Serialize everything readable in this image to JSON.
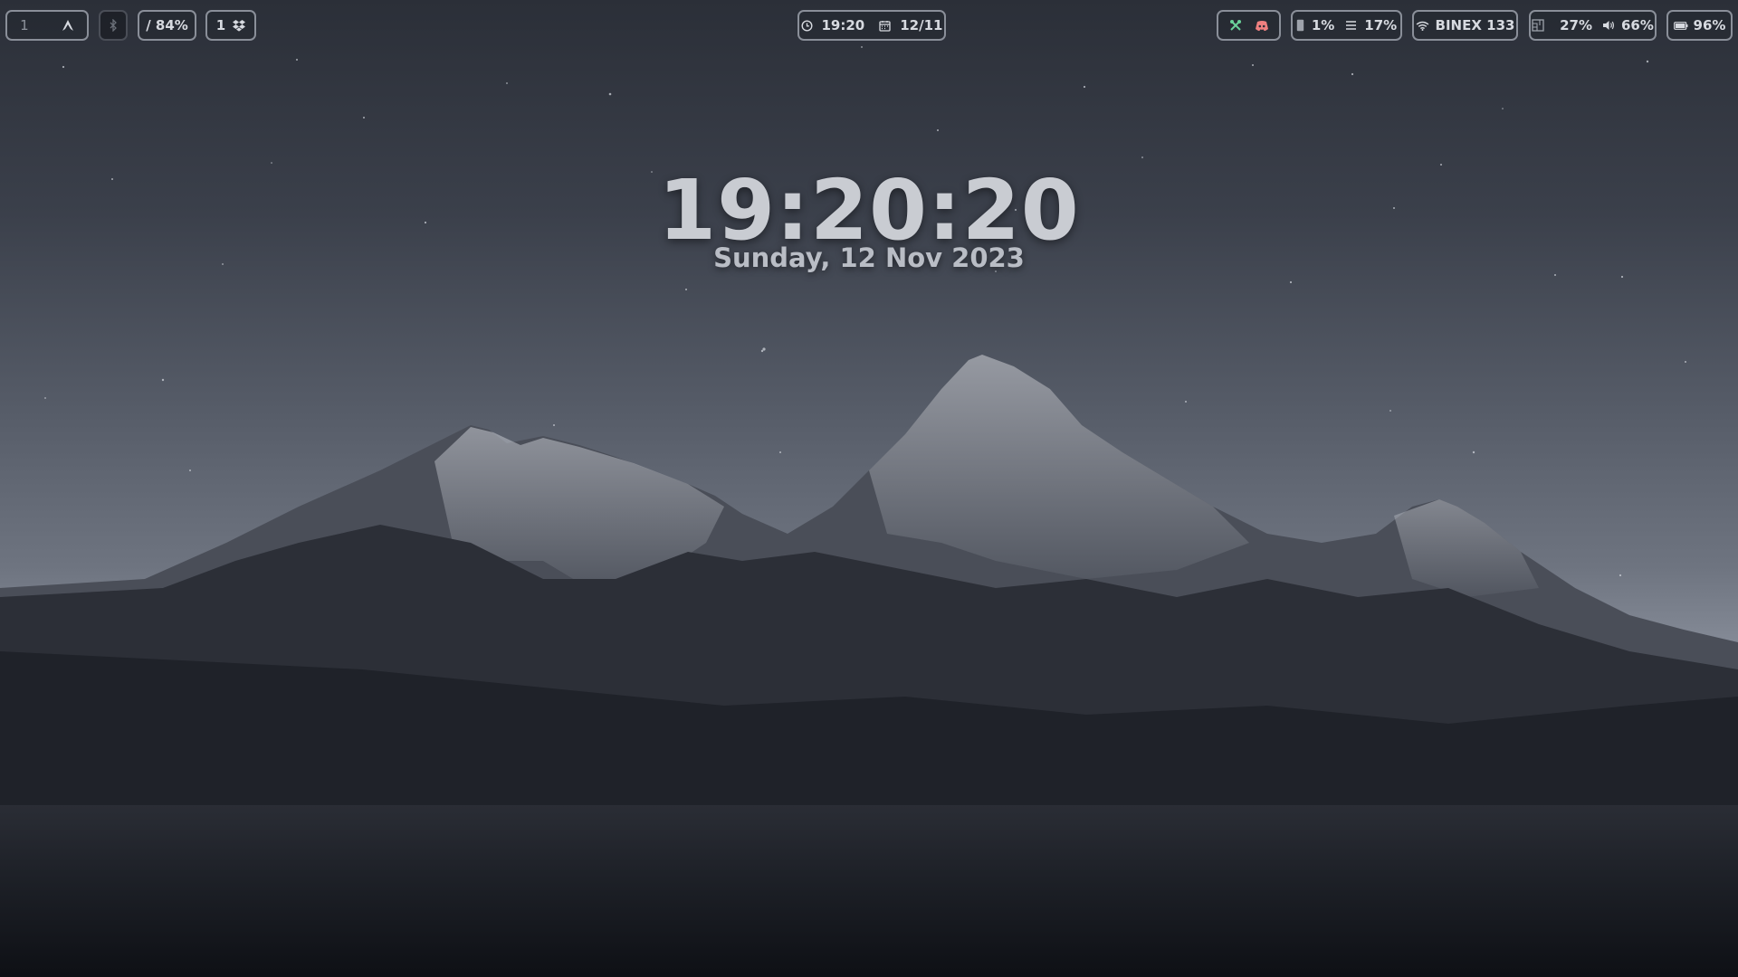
{
  "bar": {
    "workspaces": {
      "current": "1"
    },
    "disk": {
      "label": "/ 84%"
    },
    "updates": {
      "count": "1"
    },
    "clock": {
      "time": "19:20",
      "date": "12/11"
    },
    "cpu": {
      "value": "1%"
    },
    "memory": {
      "value": "17%"
    },
    "network": {
      "ssid": "BINEX 133"
    },
    "brightness": {
      "value": "27%"
    },
    "volume": {
      "value": "66%"
    },
    "battery": {
      "value": "96%"
    }
  },
  "widget": {
    "time": "19:20:20",
    "date": "Sunday, 12 Nov 2023"
  },
  "icons": {
    "arch": "arch-logo-icon",
    "bluetooth": "bluetooth-icon",
    "dropbox": "dropbox-icon",
    "clock": "clock-icon",
    "calendar": "calendar-icon",
    "tray_app": "tools-icon",
    "discord": "discord-icon",
    "cpu": "cpu-icon",
    "memory": "memory-icon",
    "wifi": "wifi-icon",
    "brightness": "brightness-icon",
    "volume": "volume-icon",
    "battery": "battery-icon"
  },
  "colors": {
    "bar_border": "#8a8f99",
    "bar_text": "#d7dae0",
    "tray_green": "#6ad29a",
    "discord_red": "#f08080"
  }
}
